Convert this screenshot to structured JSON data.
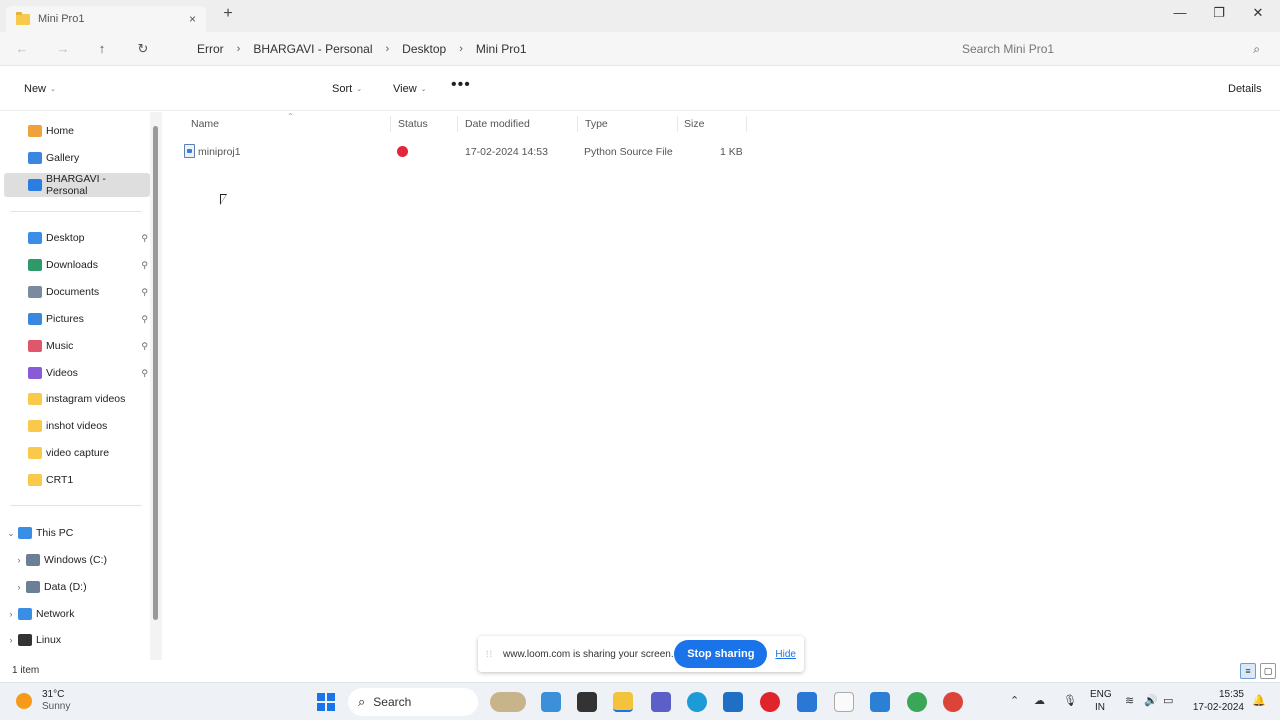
{
  "window": {
    "tab_title": "Mini Pro1",
    "tab_close": "×",
    "new_tab": "+",
    "controls": {
      "minimize": "—",
      "maximize": "❐",
      "close": "✕"
    }
  },
  "address": {
    "back": "←",
    "forward": "→",
    "up": "↑",
    "refresh": "↻",
    "breadcrumbs": [
      "Error",
      "BHARGAVI - Personal",
      "Desktop",
      "Mini Pro1"
    ],
    "separator": "›",
    "search_placeholder": "Search Mini Pro1",
    "search_glyph": "⌕"
  },
  "commands": {
    "new": "New",
    "sort": "Sort",
    "view": "View",
    "more": "•••",
    "details": "Details",
    "caret": "⌄"
  },
  "sidebar": {
    "items": [
      {
        "label": "Home",
        "icon": "home-icon",
        "color": "#f0a23a"
      },
      {
        "label": "Gallery",
        "icon": "gallery-icon",
        "color": "#3a87e0"
      },
      {
        "label": "BHARGAVI - Personal",
        "icon": "cloud-icon",
        "color": "#2a7de1",
        "selected": true
      },
      {
        "label": "Desktop",
        "icon": "desktop-icon",
        "color": "#3a8ee6",
        "pinned": true
      },
      {
        "label": "Downloads",
        "icon": "download-icon",
        "color": "#2e9a6a",
        "pinned": true
      },
      {
        "label": "Documents",
        "icon": "documents-icon",
        "color": "#7a8aa0",
        "pinned": true
      },
      {
        "label": "Pictures",
        "icon": "pictures-icon",
        "color": "#3a87e0",
        "pinned": true
      },
      {
        "label": "Music",
        "icon": "music-icon",
        "color": "#e0566a",
        "pinned": true
      },
      {
        "label": "Videos",
        "icon": "videos-icon",
        "color": "#8a5bd6",
        "pinned": true
      },
      {
        "label": "instagram videos",
        "icon": "folder-icon",
        "color": "#f8c94a"
      },
      {
        "label": "inshot videos",
        "icon": "folder-icon",
        "color": "#f8c94a"
      },
      {
        "label": "video capture",
        "icon": "folder-icon",
        "color": "#f8c94a"
      },
      {
        "label": "CRT1",
        "icon": "folder-icon",
        "color": "#f8c94a"
      },
      {
        "label": "This PC",
        "icon": "pc-icon",
        "color": "#3a8ee6",
        "expand": "⌄"
      },
      {
        "label": "Windows (C:)",
        "icon": "drive-icon",
        "color": "#6d7f96",
        "expand": "›"
      },
      {
        "label": "Data (D:)",
        "icon": "drive-icon",
        "color": "#6d7f96",
        "expand": "›"
      },
      {
        "label": "Network",
        "icon": "network-icon",
        "color": "#3a8ee6",
        "expand": "›"
      },
      {
        "label": "Linux",
        "icon": "linux-icon",
        "color": "#333333",
        "expand": "›"
      }
    ],
    "pin_glyph": "📌"
  },
  "columns": {
    "name": "Name",
    "status": "Status",
    "date": "Date modified",
    "type": "Type",
    "size": "Size",
    "sort_glyph": "⌃"
  },
  "files": [
    {
      "name": "miniproj1",
      "date": "17-02-2024 14:53",
      "type": "Python Source File",
      "size": "1 KB",
      "status_color": "#e2263b"
    }
  ],
  "status": {
    "count": "1 item"
  },
  "loom": {
    "handle": "⁞⁞",
    "message": "www.loom.com is sharing your screen.",
    "stop": "Stop sharing",
    "hide": "Hide"
  },
  "taskbar": {
    "temp": "31°C",
    "condition": "Sunny",
    "search": "Search",
    "search_glyph": "⌕",
    "lang_top": "ENG",
    "lang_bottom": "IN",
    "time": "15:35",
    "date": "17-02-2024",
    "tray_up": "⌃"
  }
}
